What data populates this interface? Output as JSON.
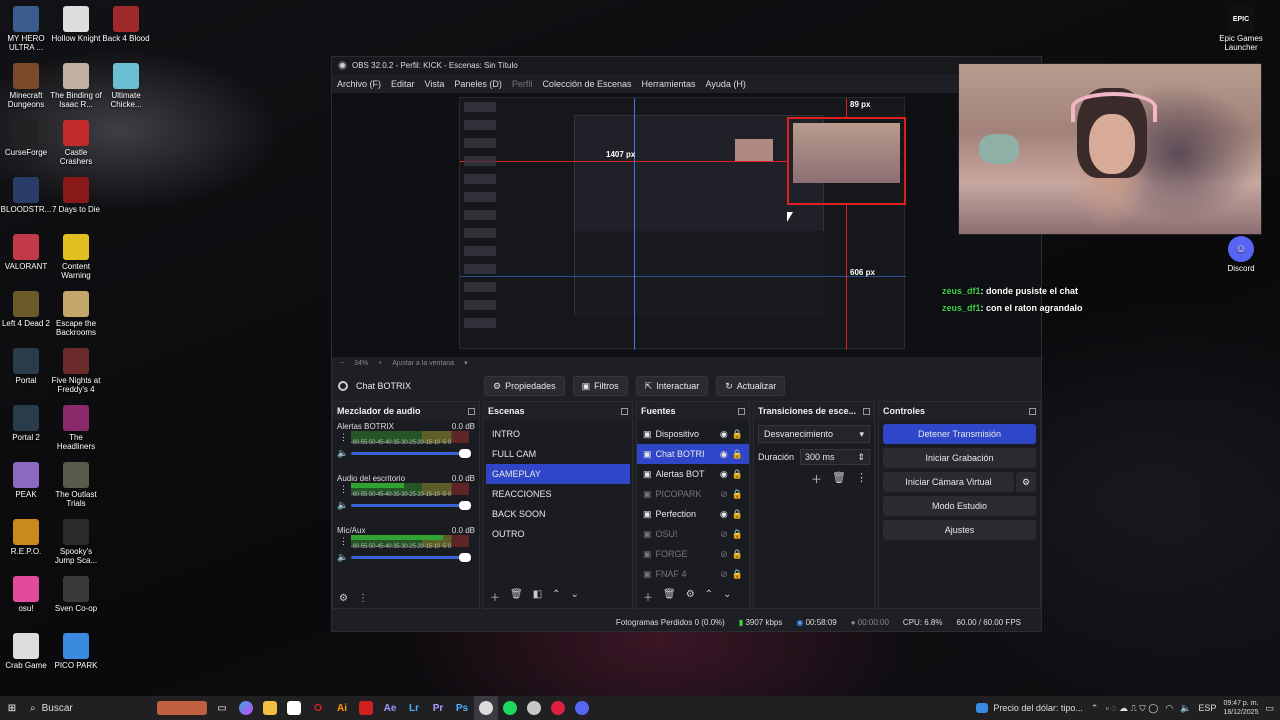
{
  "desktop": {
    "icons_left": [
      {
        "label": "MY HERO ULTRA ...",
        "color": "#3a5c8c"
      },
      {
        "label": "Minecraft Dungeons",
        "color": "#7a4a2a"
      },
      {
        "label": "CurseForge",
        "color": "#222222"
      },
      {
        "label": "BLOODSTR...",
        "color": "#2a3c6a"
      },
      {
        "label": "VALORANT",
        "color": "#c23a4a"
      },
      {
        "label": "Left 4 Dead 2",
        "color": "#6a5a2a"
      },
      {
        "label": "Portal",
        "color": "#2a3c4a"
      },
      {
        "label": "Portal 2",
        "color": "#2a3c4a"
      },
      {
        "label": "PEAK",
        "color": "#8a6ac0"
      },
      {
        "label": "R.E.P.O.",
        "color": "#c88a1a"
      },
      {
        "label": "osu!",
        "color": "#e24a9a"
      },
      {
        "label": "Crab Game",
        "color": "#dcdcdc"
      }
    ],
    "icons_right_col": [
      {
        "label": "Hollow Knight",
        "color": "#dddddd"
      },
      {
        "label": "The Binding of Isaac R...",
        "color": "#c2b0a0"
      },
      {
        "label": "Castle Crashers",
        "color": "#c22a2a"
      },
      {
        "label": "7 Days to Die",
        "color": "#8a1a1a"
      },
      {
        "label": "Content Warning",
        "color": "#e0c020"
      },
      {
        "label": "Escape the Backrooms",
        "color": "#c2a66a"
      },
      {
        "label": "Five Nights at Freddy's 4",
        "color": "#6a2a2a"
      },
      {
        "label": "The Headliners",
        "color": "#8a2a6a"
      },
      {
        "label": "The Outlast Trials",
        "color": "#5a5a4a"
      },
      {
        "label": "Spooky's Jump Sca...",
        "color": "#2a2a2a"
      },
      {
        "label": "Sven Co-op",
        "color": "#3a3a3a"
      },
      {
        "label": "PICO PARK",
        "color": "#3a8ae0"
      }
    ],
    "icons_third": [
      {
        "label": "Back 4 Blood",
        "color": "#a02a2a"
      },
      {
        "label": "Ultimate Chicke...",
        "color": "#6ac0d0"
      }
    ],
    "epic": {
      "label": "Epic Games Launcher",
      "badge": "EPIC"
    },
    "discord": {
      "label": "Discord"
    }
  },
  "obs": {
    "title": "OBS 32.0.2 - Perfil: KICK - Escenas: Sin Título",
    "menu": [
      "Archivo (F)",
      "Editar",
      "Vista",
      "Paneles (D)",
      "Perfil",
      "Colección de Escenas",
      "Herramientas",
      "Ayuda (H)"
    ],
    "preview_labels": {
      "top": "89 px",
      "left": "1407 px",
      "right": "606 px"
    },
    "zoom": {
      "minus": "−",
      "value": "34%",
      "plus": "+",
      "fit": "Ajustar a la ventana"
    },
    "selected_source": "Chat BOTRIX",
    "toolbar": {
      "properties": "Propiedades",
      "filters": "Filtros",
      "interact": "Interactuar",
      "refresh": "Actualizar"
    },
    "mixer": {
      "title": "Mezclador de audio",
      "scale": "-60-55-50-45-40-35-30-25-20-15-10 -5 0",
      "channels": [
        {
          "name": "Alertas BOTRIX",
          "db": "0.0 dB",
          "level": 0
        },
        {
          "name": "Audio del escritorio",
          "db": "0.0 dB",
          "level": 0.45
        },
        {
          "name": "Mic/Aux",
          "db": "0.0 dB",
          "level": 0.78
        }
      ]
    },
    "scenes": {
      "title": "Escenas",
      "items": [
        "INTRO",
        "FULL CAM",
        "GAMEPLAY",
        "REACCIONES",
        "BACK SOON",
        "OUTRO"
      ],
      "active": "GAMEPLAY"
    },
    "sources": {
      "title": "Fuentes",
      "items": [
        {
          "name": "Dispositivo",
          "visible": true
        },
        {
          "name": "Chat BOTRI",
          "visible": true,
          "active": true
        },
        {
          "name": "Alertas BOT",
          "visible": true
        },
        {
          "name": "PICOPARK",
          "visible": false
        },
        {
          "name": "Perfection",
          "visible": true
        },
        {
          "name": "OSU!",
          "visible": false
        },
        {
          "name": "FORGE",
          "visible": false
        },
        {
          "name": "FNAF 4",
          "visible": false
        }
      ]
    },
    "transitions": {
      "title": "Transiciones de esce...",
      "type": "Desvanecimiento",
      "duration_label": "Duración",
      "duration_value": "300 ms"
    },
    "controls": {
      "title": "Controles",
      "stop_stream": "Detener Transmisión",
      "start_record": "Iniciar Grabación",
      "virtual_cam": "Iniciar Cámara Virtual",
      "studio_mode": "Modo Estudio",
      "settings": "Ajustes"
    },
    "status": {
      "dropped": "Fotogramas Perdidos 0 (0.0%)",
      "bitrate": "3907 kbps",
      "stream_time": "00:58:09",
      "rec_time": "00:00:00",
      "cpu": "CPU: 6.8%",
      "fps": "60.00 / 60.00 FPS"
    }
  },
  "chat": [
    {
      "user": "zeus_df1",
      "msg": ": donde pusiste el chat"
    },
    {
      "user": "zeus_df1",
      "msg": ": con el raton agrandalo"
    }
  ],
  "taskbar": {
    "search": "Buscar",
    "news": "Precio del dólar: tipo...",
    "lang": "ESP",
    "time": "09:47 p. m.",
    "date": "18/12/2025"
  }
}
